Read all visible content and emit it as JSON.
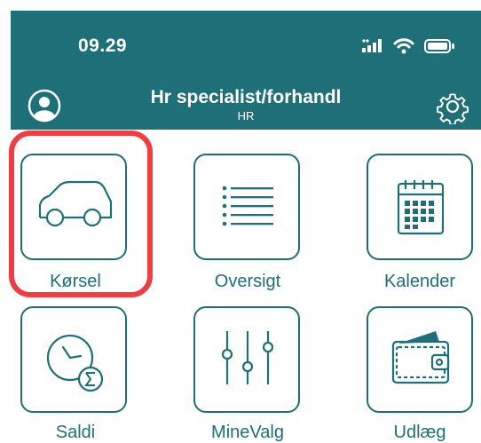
{
  "status_bar": {
    "time": "09.29",
    "icons": [
      "signal-icon",
      "wifi-icon",
      "battery-icon"
    ]
  },
  "header": {
    "title": "Hr specialist/forhandl",
    "subtitle": "HR",
    "left_icon": "user-avatar-icon",
    "right_icon": "gear-icon"
  },
  "menu": {
    "items": [
      {
        "label": "Kørsel",
        "icon": "car-icon",
        "highlighted": true
      },
      {
        "label": "Oversigt",
        "icon": "list-icon"
      },
      {
        "label": "Kalender",
        "icon": "calendar-icon"
      },
      {
        "label": "Saldi",
        "icon": "clock-sum-icon"
      },
      {
        "label": "MineValg",
        "icon": "sliders-icon"
      },
      {
        "label": "Udlæg",
        "icon": "wallet-icon"
      }
    ]
  },
  "colors": {
    "primary": "#1f6f78",
    "highlight": "#ee3d43",
    "background": "#ffffff"
  }
}
